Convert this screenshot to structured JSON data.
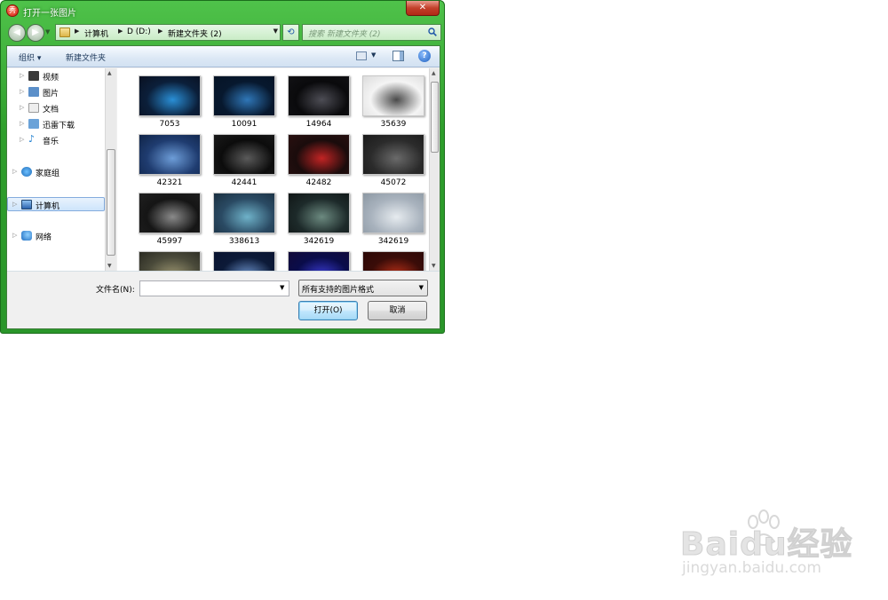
{
  "window": {
    "title": "打开一张图片",
    "app_icon_text": "秀",
    "close_label": "✕"
  },
  "address": {
    "crumbs": [
      "计算机",
      "D (D:)",
      "新建文件夹 (2)"
    ]
  },
  "search": {
    "placeholder": "搜索 新建文件夹 (2)"
  },
  "toolbar": {
    "organize": "组织 ▾",
    "new_folder": "新建文件夹",
    "help": "?"
  },
  "nav_tree": {
    "items": [
      {
        "label": "视频",
        "color": "#3a3a3a"
      },
      {
        "label": "图片",
        "color": "#5b8fc9"
      },
      {
        "label": "文档",
        "color": "#e8e8e8"
      },
      {
        "label": "迅雷下载",
        "color": "#6aa2d8"
      },
      {
        "label": "音乐",
        "color": "#1e7fd0"
      },
      {
        "label": "家庭组",
        "color": "#2d8bd6"
      },
      {
        "label": "计算机",
        "color": "#4a7fc0"
      },
      {
        "label": "网络",
        "color": "#2a76c9"
      }
    ]
  },
  "files": {
    "items": [
      {
        "label": "7053",
        "colors": [
          "#0b1f3a",
          "#2a8fd6",
          "#0a1020"
        ]
      },
      {
        "label": "10091",
        "colors": [
          "#07182e",
          "#2f77b8",
          "#061426"
        ]
      },
      {
        "label": "14964",
        "colors": [
          "#0a0a0c",
          "#4d4d55",
          "#121215"
        ]
      },
      {
        "label": "35639",
        "colors": [
          "#f4f4f4",
          "#4a4a4a",
          "#dcdcdc"
        ]
      },
      {
        "label": "42321",
        "colors": [
          "#1f3c70",
          "#6d9dd8",
          "#102447"
        ]
      },
      {
        "label": "42441",
        "colors": [
          "#0c0c0c",
          "#5a5a5a",
          "#1a1a1a"
        ]
      },
      {
        "label": "42482",
        "colors": [
          "#1a0c0c",
          "#c22424",
          "#2a1010"
        ]
      },
      {
        "label": "45072",
        "colors": [
          "#2b2b2b",
          "#6a6a6a",
          "#1a1a1a"
        ]
      },
      {
        "label": "45997",
        "colors": [
          "#151515",
          "#8a8a8a",
          "#202020"
        ]
      },
      {
        "label": "338613",
        "colors": [
          "#2a4a63",
          "#6fb2c9",
          "#1a2f40"
        ]
      },
      {
        "label": "342619",
        "colors": [
          "#1d2a2a",
          "#6c8a80",
          "#101616"
        ]
      },
      {
        "label": "342619",
        "colors": [
          "#a8b2bd",
          "#e6ebef",
          "#8c98a3"
        ]
      },
      {
        "label": "",
        "colors": [
          "#4a4a3a",
          "#9a9470",
          "#2a2a22"
        ]
      },
      {
        "label": "",
        "colors": [
          "#0c1a38",
          "#6a90c8",
          "#0a1430"
        ]
      },
      {
        "label": "",
        "colors": [
          "#0a0c4a",
          "#3a3ad0",
          "#120a38"
        ]
      },
      {
        "label": "",
        "colors": [
          "#3a0c08",
          "#b83018",
          "#2a0806"
        ]
      }
    ]
  },
  "bottom": {
    "file_name_label": "文件名(N):",
    "file_name_value": "",
    "file_type": "所有支持的图片格式",
    "open_button": "打开(O)",
    "cancel_button": "取消"
  },
  "watermark": {
    "brand": "Baidu经验",
    "url": "jingyan.baidu.com"
  }
}
